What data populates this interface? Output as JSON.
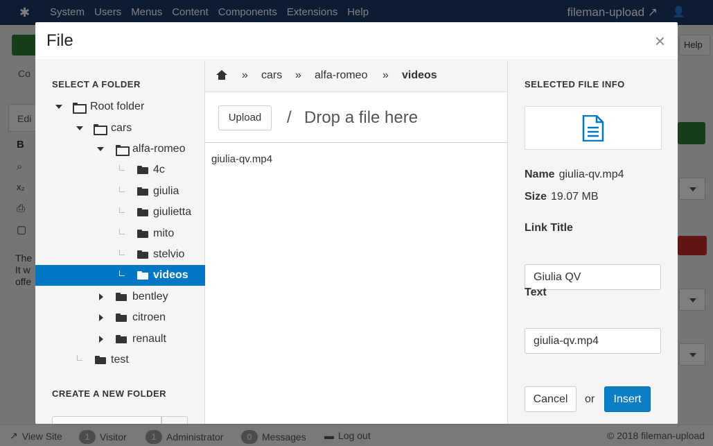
{
  "background": {
    "topbar": {
      "menu": [
        "System",
        "Users",
        "Menus",
        "Content",
        "Components",
        "Extensions",
        "Help"
      ],
      "site_name": "fileman-upload",
      "logo_icon": "joomla-logo-icon",
      "user_icon": "user-icon"
    },
    "help_label": "Help",
    "content_label": "Co",
    "edit_label": "Edi",
    "body_text": [
      "The",
      "It w",
      "offe"
    ],
    "statusbar": {
      "view_site": "View Site",
      "visitor_count": "1",
      "visitor_label": "Visitor",
      "admin_count": "1",
      "admin_label": "Administrator",
      "messages_count": "0",
      "messages_label": "Messages",
      "logout_label": "Log out",
      "copyright": "© 2018 fileman-upload"
    }
  },
  "modal": {
    "title": "File",
    "close_symbol": "×",
    "left": {
      "select_folder_label": "SELECT A FOLDER",
      "create_folder_label": "CREATE A NEW FOLDER",
      "tree": [
        {
          "label": "Root folder",
          "state": "expanded"
        },
        {
          "label": "cars",
          "state": "expanded"
        },
        {
          "label": "alfa-romeo",
          "state": "expanded"
        },
        {
          "label": "4c",
          "state": "leaf"
        },
        {
          "label": "giulia",
          "state": "leaf"
        },
        {
          "label": "giulietta",
          "state": "leaf"
        },
        {
          "label": "mito",
          "state": "leaf"
        },
        {
          "label": "stelvio",
          "state": "leaf"
        },
        {
          "label": "videos",
          "state": "leaf",
          "selected": true
        },
        {
          "label": "bentley",
          "state": "collapsed"
        },
        {
          "label": "citroen",
          "state": "collapsed"
        },
        {
          "label": "renault",
          "state": "collapsed"
        },
        {
          "label": "test",
          "state": "leaf"
        }
      ]
    },
    "middle": {
      "breadcrumb": {
        "home_icon": "home-icon",
        "separator": "»",
        "items": [
          "cars",
          "alfa-romeo",
          "videos"
        ]
      },
      "upload_label": "Upload",
      "drop_slash": "/",
      "drop_text": "Drop a file here",
      "files": [
        "giulia-qv.mp4"
      ]
    },
    "right": {
      "section_label": "SELECTED FILE INFO",
      "preview_icon": "document-icon",
      "name_label": "Name",
      "name_value": "giulia-qv.mp4",
      "size_label": "Size",
      "size_value": "19.07 MB",
      "link_title_label": "Link Title",
      "link_title_value": "Giulia QV",
      "text_label": "Text",
      "text_value": "giulia-qv.mp4",
      "cancel_label": "Cancel",
      "or_label": "or",
      "insert_label": "Insert",
      "accent_color": "#0077c2"
    }
  }
}
